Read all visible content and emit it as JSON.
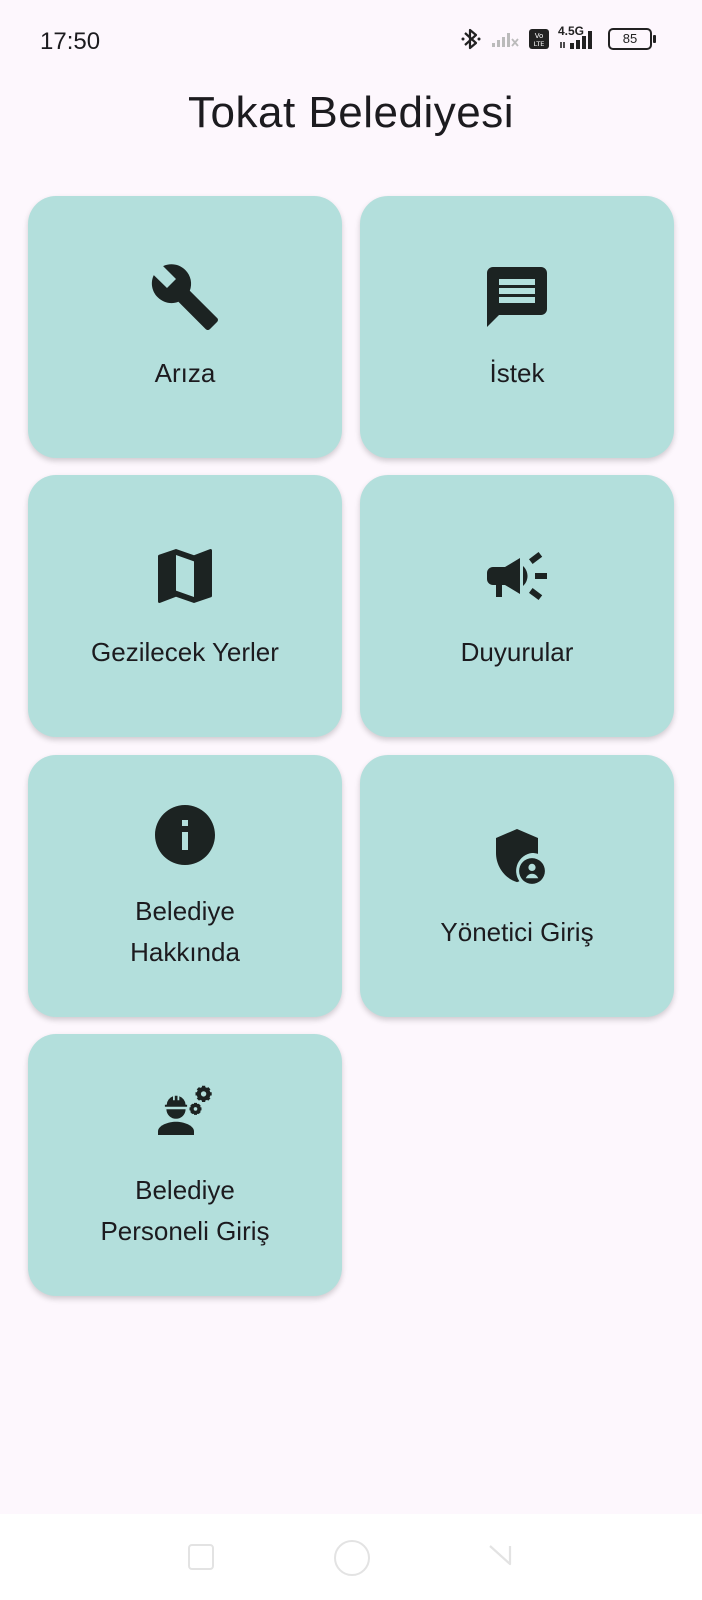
{
  "status_bar": {
    "time": "17:50",
    "network": "4.5G",
    "battery": "85",
    "icons": [
      "bluetooth-icon",
      "signal-weak-icon",
      "volte-icon",
      "signal-icon",
      "battery-icon"
    ]
  },
  "app": {
    "title": "Tokat Belediyesi"
  },
  "menu": {
    "items": [
      {
        "label": "Arıza",
        "icon": "wrench-icon"
      },
      {
        "label": "İstek",
        "icon": "message-icon"
      },
      {
        "label": "Gezilecek Yerler",
        "icon": "map-icon"
      },
      {
        "label": "Duyurular",
        "icon": "megaphone-icon"
      },
      {
        "label": "Belediye\nHakkında",
        "icon": "info-icon"
      },
      {
        "label": "Yönetici Giriş",
        "icon": "admin-shield-icon"
      },
      {
        "label": "Belediye\nPersoneli Giriş",
        "icon": "worker-gears-icon"
      }
    ]
  },
  "colors": {
    "background": "#fdf7fd",
    "tile": "#b3dfdc",
    "text": "#1c1b1f",
    "icon": "#1c2322"
  },
  "nav": {
    "icons": [
      "back-square-icon",
      "home-circle-icon",
      "recent-triangle-icon"
    ]
  }
}
